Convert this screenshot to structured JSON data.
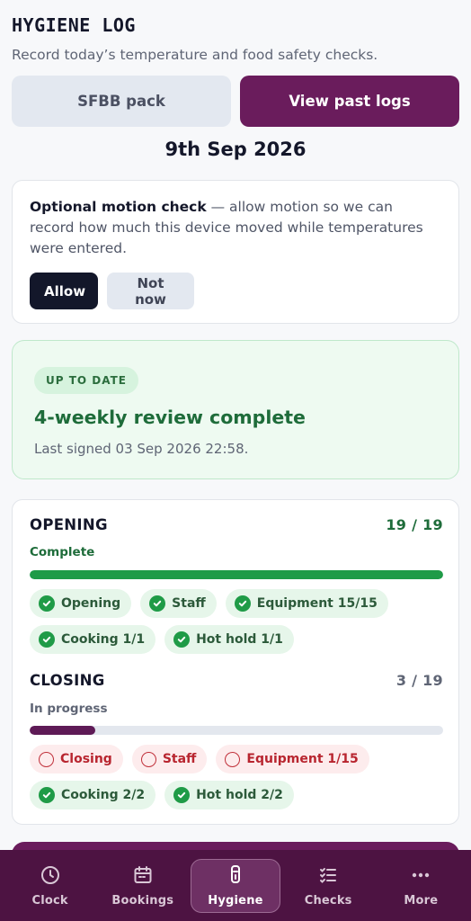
{
  "header": {
    "title": "HYGIENE LOG",
    "subtitle": "Record today’s temperature and food safety checks."
  },
  "actions": {
    "sfbb_label": "SFBB pack",
    "past_logs_label": "View past logs"
  },
  "date": "9th Sep 2026",
  "motion": {
    "title": "Optional motion check",
    "body": " — allow motion so we can record how much this device moved while temperatures were entered.",
    "allow_label": "Allow",
    "not_now_label": "Not now"
  },
  "review": {
    "badge": "UP TO DATE",
    "title": "4-weekly review complete",
    "subtitle": "Last signed 03 Sep 2026 22:58."
  },
  "opening": {
    "title": "OPENING",
    "count": "19 / 19",
    "state": "Complete",
    "progress": 1.0,
    "chips": [
      {
        "label": "Opening",
        "done": true
      },
      {
        "label": "Staff",
        "done": true
      },
      {
        "label": "Equipment 15/15",
        "done": true
      },
      {
        "label": "Cooking 1/1",
        "done": true
      },
      {
        "label": "Hot hold 1/1",
        "done": true
      }
    ]
  },
  "closing": {
    "title": "CLOSING",
    "count": "3 / 19",
    "state": "In progress",
    "progress": 0.158,
    "chips": [
      {
        "label": "Closing",
        "done": false
      },
      {
        "label": "Staff",
        "done": false
      },
      {
        "label": "Equipment 1/15",
        "done": false
      },
      {
        "label": "Cooking 2/2",
        "done": true
      },
      {
        "label": "Hot hold 2/2",
        "done": true
      }
    ]
  },
  "nav": {
    "items": [
      {
        "label": "Clock",
        "icon": "clock-icon"
      },
      {
        "label": "Bookings",
        "icon": "calendar-icon"
      },
      {
        "label": "Hygiene",
        "icon": "thermometer-icon",
        "active": true
      },
      {
        "label": "Checks",
        "icon": "checklist-icon"
      },
      {
        "label": "More",
        "icon": "more-dots-icon"
      }
    ]
  },
  "colors": {
    "primary": "#6a1c5c",
    "nav_bg": "#4d1342",
    "success": "#1f9b47",
    "danger": "#c0303a",
    "progress_closing": "#5e1a56"
  }
}
